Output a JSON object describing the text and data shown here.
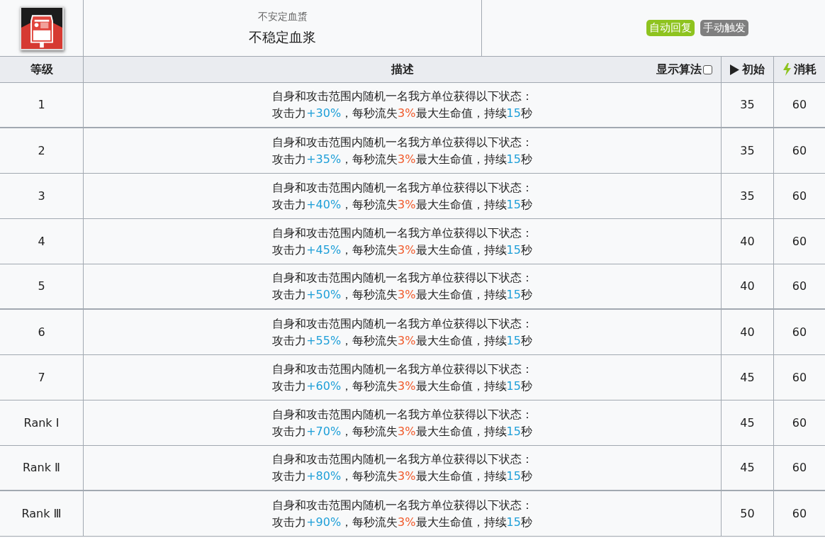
{
  "skill": {
    "subtitle": "不安定血螀",
    "name": "不稳定血浆",
    "tags": [
      {
        "label": "自动回复",
        "color": "#8ec31f"
      },
      {
        "label": "手动触发",
        "color": "#7f7f7f"
      }
    ]
  },
  "table": {
    "columns": [
      {
        "kind": "text",
        "label": "等级"
      },
      {
        "kind": "text",
        "label": "描述"
      },
      {
        "kind": "initial",
        "label": "初始"
      },
      {
        "kind": "cost",
        "label": "消耗"
      }
    ],
    "formula_toggle": {
      "label": "显示算法",
      "checked": false
    },
    "rows": [
      {
        "level": "1",
        "line1": "自身和攻击范围内随机一名我方单位获得以下状态：",
        "line2": [
          {
            "kind": "plain",
            "text": "攻击力"
          },
          {
            "kind": "up",
            "text": "+30%"
          },
          {
            "kind": "plain",
            "text": "，每秒流失"
          },
          {
            "kind": "down",
            "text": "3%"
          },
          {
            "kind": "plain",
            "text": "最大生命值，持续"
          },
          {
            "kind": "up",
            "text": "15"
          },
          {
            "kind": "plain",
            "text": "秒"
          }
        ],
        "initial": "35",
        "cost": "60"
      },
      {
        "level": "2",
        "line1": "自身和攻击范围内随机一名我方单位获得以下状态：",
        "line2": [
          {
            "kind": "plain",
            "text": "攻击力"
          },
          {
            "kind": "up",
            "text": "+35%"
          },
          {
            "kind": "plain",
            "text": "，每秒流失"
          },
          {
            "kind": "down",
            "text": "3%"
          },
          {
            "kind": "plain",
            "text": "最大生命值，持续"
          },
          {
            "kind": "up",
            "text": "15"
          },
          {
            "kind": "plain",
            "text": "秒"
          }
        ],
        "initial": "35",
        "cost": "60"
      },
      {
        "level": "3",
        "line1": "自身和攻击范围内随机一名我方单位获得以下状态：",
        "line2": [
          {
            "kind": "plain",
            "text": "攻击力"
          },
          {
            "kind": "up",
            "text": "+40%"
          },
          {
            "kind": "plain",
            "text": "，每秒流失"
          },
          {
            "kind": "down",
            "text": "3%"
          },
          {
            "kind": "plain",
            "text": "最大生命值，持续"
          },
          {
            "kind": "up",
            "text": "15"
          },
          {
            "kind": "plain",
            "text": "秒"
          }
        ],
        "initial": "35",
        "cost": "60"
      },
      {
        "level": "4",
        "line1": "自身和攻击范围内随机一名我方单位获得以下状态：",
        "line2": [
          {
            "kind": "plain",
            "text": "攻击力"
          },
          {
            "kind": "up",
            "text": "+45%"
          },
          {
            "kind": "plain",
            "text": "，每秒流失"
          },
          {
            "kind": "down",
            "text": "3%"
          },
          {
            "kind": "plain",
            "text": "最大生命值，持续"
          },
          {
            "kind": "up",
            "text": "15"
          },
          {
            "kind": "plain",
            "text": "秒"
          }
        ],
        "initial": "40",
        "cost": "60"
      },
      {
        "level": "5",
        "line1": "自身和攻击范围内随机一名我方单位获得以下状态：",
        "line2": [
          {
            "kind": "plain",
            "text": "攻击力"
          },
          {
            "kind": "up",
            "text": "+50%"
          },
          {
            "kind": "plain",
            "text": "，每秒流失"
          },
          {
            "kind": "down",
            "text": "3%"
          },
          {
            "kind": "plain",
            "text": "最大生命值，持续"
          },
          {
            "kind": "up",
            "text": "15"
          },
          {
            "kind": "plain",
            "text": "秒"
          }
        ],
        "initial": "40",
        "cost": "60"
      },
      {
        "level": "6",
        "line1": "自身和攻击范围内随机一名我方单位获得以下状态：",
        "line2": [
          {
            "kind": "plain",
            "text": "攻击力"
          },
          {
            "kind": "up",
            "text": "+55%"
          },
          {
            "kind": "plain",
            "text": "，每秒流失"
          },
          {
            "kind": "down",
            "text": "3%"
          },
          {
            "kind": "plain",
            "text": "最大生命值，持续"
          },
          {
            "kind": "up",
            "text": "15"
          },
          {
            "kind": "plain",
            "text": "秒"
          }
        ],
        "initial": "40",
        "cost": "60"
      },
      {
        "level": "7",
        "line1": "自身和攻击范围内随机一名我方单位获得以下状态：",
        "line2": [
          {
            "kind": "plain",
            "text": "攻击力"
          },
          {
            "kind": "up",
            "text": "+60%"
          },
          {
            "kind": "plain",
            "text": "，每秒流失"
          },
          {
            "kind": "down",
            "text": "3%"
          },
          {
            "kind": "plain",
            "text": "最大生命值，持续"
          },
          {
            "kind": "up",
            "text": "15"
          },
          {
            "kind": "plain",
            "text": "秒"
          }
        ],
        "initial": "45",
        "cost": "60"
      },
      {
        "level": "Rank Ⅰ",
        "line1": "自身和攻击范围内随机一名我方单位获得以下状态：",
        "line2": [
          {
            "kind": "plain",
            "text": "攻击力"
          },
          {
            "kind": "up",
            "text": "+70%"
          },
          {
            "kind": "plain",
            "text": "，每秒流失"
          },
          {
            "kind": "down",
            "text": "3%"
          },
          {
            "kind": "plain",
            "text": "最大生命值，持续"
          },
          {
            "kind": "up",
            "text": "15"
          },
          {
            "kind": "plain",
            "text": "秒"
          }
        ],
        "initial": "45",
        "cost": "60"
      },
      {
        "level": "Rank Ⅱ",
        "line1": "自身和攻击范围内随机一名我方单位获得以下状态：",
        "line2": [
          {
            "kind": "plain",
            "text": "攻击力"
          },
          {
            "kind": "up",
            "text": "+80%"
          },
          {
            "kind": "plain",
            "text": "，每秒流失"
          },
          {
            "kind": "down",
            "text": "3%"
          },
          {
            "kind": "plain",
            "text": "最大生命值，持续"
          },
          {
            "kind": "up",
            "text": "15"
          },
          {
            "kind": "plain",
            "text": "秒"
          }
        ],
        "initial": "45",
        "cost": "60"
      },
      {
        "level": "Rank Ⅲ",
        "line1": "自身和攻击范围内随机一名我方单位获得以下状态：",
        "line2": [
          {
            "kind": "plain",
            "text": "攻击力"
          },
          {
            "kind": "up",
            "text": "+90%"
          },
          {
            "kind": "plain",
            "text": "，每秒流失"
          },
          {
            "kind": "down",
            "text": "3%"
          },
          {
            "kind": "plain",
            "text": "最大生命值，持续"
          },
          {
            "kind": "up",
            "text": "15"
          },
          {
            "kind": "plain",
            "text": "秒"
          }
        ],
        "initial": "50",
        "cost": "60"
      }
    ]
  }
}
